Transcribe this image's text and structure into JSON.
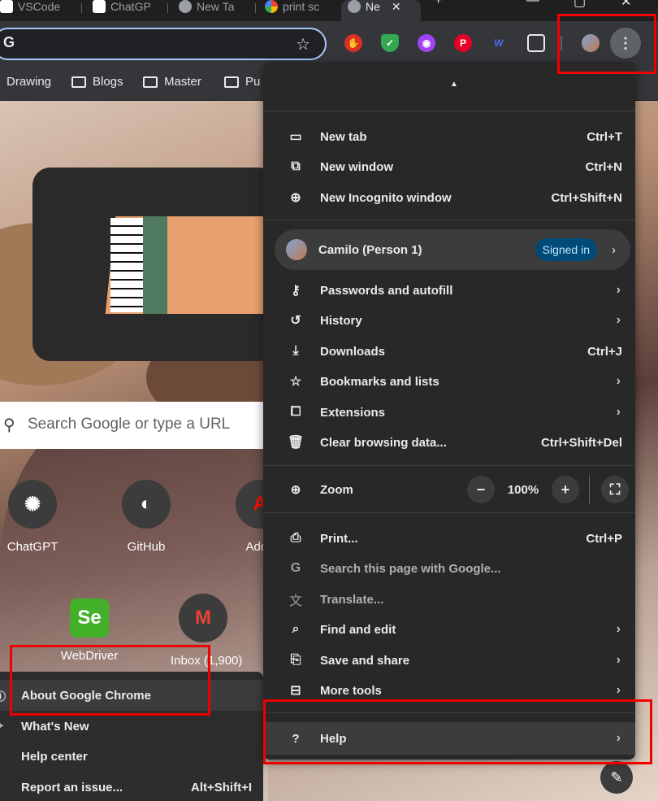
{
  "tabs": [
    {
      "label": "VSCode"
    },
    {
      "label": "ChatGP"
    },
    {
      "label": "New Ta"
    },
    {
      "label": "print sc"
    },
    {
      "label": "Ne",
      "active": true
    }
  ],
  "toolbar": {
    "omnibox_glyph": "G",
    "bookmark_star": "☆",
    "menu_glyph": "⋮"
  },
  "bookmarks": [
    {
      "label": "Drawing"
    },
    {
      "label": "Blogs"
    },
    {
      "label": "Master"
    },
    {
      "label": "Pu"
    }
  ],
  "ntp": {
    "search_placeholder": "Search Google or type a URL",
    "shortcuts": [
      {
        "label": "ChatGPT"
      },
      {
        "label": "GitHub"
      },
      {
        "label": "Adob"
      },
      {
        "label": "WebDriver"
      },
      {
        "label": "Inbox (1,900)"
      }
    ]
  },
  "menu": {
    "items_top": [
      {
        "icon": "new-tab-icon",
        "label": "New tab",
        "shortcut": "Ctrl+T"
      },
      {
        "icon": "new-window-icon",
        "label": "New window",
        "shortcut": "Ctrl+N"
      },
      {
        "icon": "incognito-icon",
        "label": "New Incognito window",
        "shortcut": "Ctrl+Shift+N"
      }
    ],
    "profile": {
      "name": "Camilo (Person 1)",
      "badge": "Signed in"
    },
    "items_mid": [
      {
        "icon": "key-icon",
        "label": "Passwords and autofill"
      },
      {
        "icon": "history-icon",
        "label": "History"
      },
      {
        "icon": "download-icon",
        "label": "Downloads",
        "shortcut": "Ctrl+J"
      },
      {
        "icon": "star-icon",
        "label": "Bookmarks and lists"
      },
      {
        "icon": "puzzle-icon",
        "label": "Extensions"
      },
      {
        "icon": "trash-icon",
        "label": "Clear browsing data...",
        "shortcut": "Ctrl+Shift+Del"
      }
    ],
    "zoom": {
      "label": "Zoom",
      "value": "100%",
      "minus": "−",
      "plus": "+"
    },
    "items_bottom": [
      {
        "icon": "print-icon",
        "label": "Print...",
        "shortcut": "Ctrl+P"
      },
      {
        "icon": "google-icon",
        "label": "Search this page with Google...",
        "disabled": true
      },
      {
        "icon": "translate-icon",
        "label": "Translate...",
        "disabled": true
      },
      {
        "icon": "find-icon",
        "label": "Find and edit"
      },
      {
        "icon": "save-icon",
        "label": "Save and share"
      },
      {
        "icon": "toolbox-icon",
        "label": "More tools"
      }
    ],
    "help": {
      "label": "Help"
    }
  },
  "help_submenu": [
    {
      "label": "About Google Chrome"
    },
    {
      "label": "What's New"
    },
    {
      "label": "Help center"
    },
    {
      "label": "Report an issue...",
      "shortcut": "Alt+Shift+I"
    }
  ],
  "colors": {
    "accent": "#a8c7fa",
    "highlight": "#e00000",
    "badge": "#004a77"
  }
}
